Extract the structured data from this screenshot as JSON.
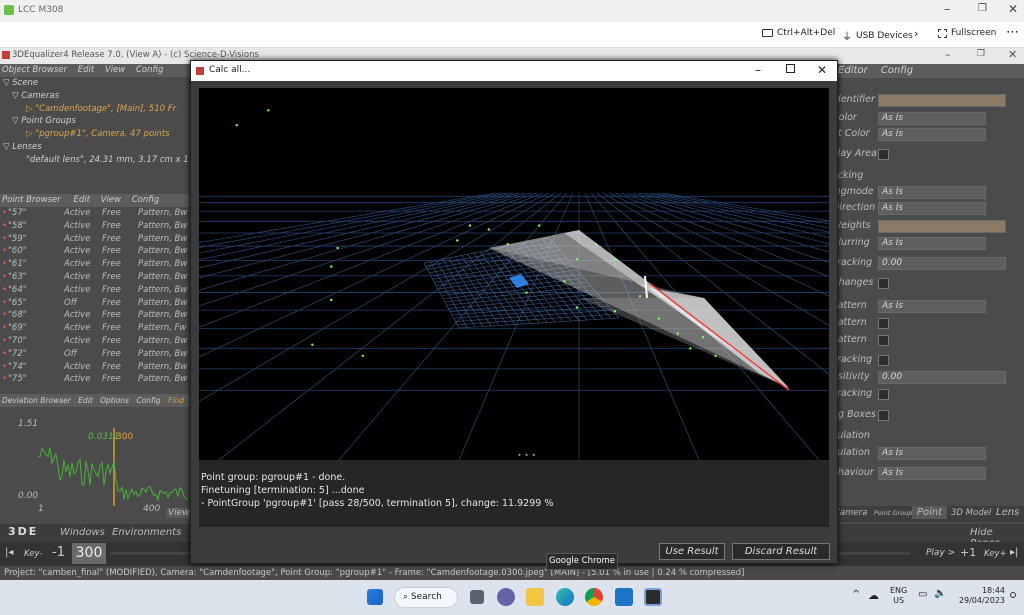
{
  "rd": {
    "title": "LCC M308",
    "ctrl_alt_del": "Ctrl+Alt+Del",
    "usb": "USB Devices",
    "fullscreen": "Fullscreen"
  },
  "app": {
    "title": "3DEqualizer4 Release 7.0, (View A)  -  (c) Science-D-Visions"
  },
  "object_browser": {
    "menu": [
      "Object Browser",
      "Edit",
      "View",
      "Config"
    ],
    "tree": [
      "Scene",
      "Cameras",
      "\"Camdenfootage\", [Main], 510 Fr",
      "Point Groups",
      "\"pgroup#1\", Camera, 47 points",
      "Lenses",
      "\"default lens\", 24.31 mm, 3.17 cm x 1"
    ]
  },
  "point_browser": {
    "menu": [
      "Point Browser",
      "Edit",
      "View",
      "Config"
    ],
    "rows": [
      [
        "\"57\"",
        "Active",
        "Free",
        "Pattern, Bw"
      ],
      [
        "\"58\"",
        "Active",
        "Free",
        "Pattern, Bw"
      ],
      [
        "\"59\"",
        "Active",
        "Free",
        "Pattern, Bw"
      ],
      [
        "\"60\"",
        "Active",
        "Free",
        "Pattern, Bw"
      ],
      [
        "\"61\"",
        "Active",
        "Free",
        "Pattern, Bw"
      ],
      [
        "\"63\"",
        "Active",
        "Free",
        "Pattern, Bw"
      ],
      [
        "\"64\"",
        "Active",
        "Free",
        "Pattern, Bw"
      ],
      [
        "\"65\"",
        "Off",
        "Free",
        "Pattern, Bw"
      ],
      [
        "\"68\"",
        "Active",
        "Free",
        "Pattern, Bw"
      ],
      [
        "\"69\"",
        "Active",
        "Free",
        "Pattern, Fw"
      ],
      [
        "\"70\"",
        "Active",
        "Free",
        "Pattern, Bw"
      ],
      [
        "\"72\"",
        "Off",
        "Free",
        "Pattern, Bw"
      ],
      [
        "\"74\"",
        "Active",
        "Free",
        "Pattern, Bw"
      ],
      [
        "\"75\"",
        "Active",
        "Free",
        "Pattern, Bw"
      ]
    ]
  },
  "deviation_browser": {
    "menu": [
      "Deviation Browser",
      "Edit",
      "Options",
      "Config",
      "Find"
    ],
    "ymax": "1.51",
    "ymin": "0.00",
    "xmin": "1",
    "xmax": "400",
    "value": "0.0311",
    "frame": "300",
    "view_btn": "View"
  },
  "dialog": {
    "title": "Calc all...",
    "console": [
      "Point group: pgroup#1 -  done.",
      "Finetuning [termination: 5] ...done",
      "- PointGroup 'pgroup#1'  [pass 28/500, termination 5], change: 11.9299 %"
    ],
    "use_result": "Use Result",
    "discard_result": "Discard Result"
  },
  "attribute_editor": {
    "menu": [
      "Editor",
      "Config"
    ],
    "rows": [
      {
        "label": "Identifier",
        "type": "text",
        "value": ""
      },
      {
        "label": "Color",
        "type": "select",
        "value": "As Is"
      },
      {
        "label": "nt Color",
        "type": "select",
        "value": "As Is"
      },
      {
        "label": "Play Area",
        "type": "check"
      },
      {
        "label": "acking",
        "type": "section"
      },
      {
        "label": "ingmode",
        "type": "select",
        "value": "As Is"
      },
      {
        "label": "Direction",
        "type": "select",
        "value": "As Is"
      },
      {
        "label": "Weights",
        "type": "text",
        "value": ""
      },
      {
        "label": "Blurring",
        "type": "select",
        "value": "As Is"
      },
      {
        "label": "Tracking",
        "type": "num",
        "value": "0.00"
      },
      {
        "label": "Changes",
        "type": "check"
      },
      {
        "label": "Pattern",
        "type": "select",
        "value": "As Is"
      },
      {
        "label": "Pattern",
        "type": "check"
      },
      {
        "label": "Pattern",
        "type": "check"
      },
      {
        "label": "Tracking",
        "type": "check"
      },
      {
        "label": "nsitivity",
        "type": "num",
        "value": "0.00"
      },
      {
        "label": "Tracking",
        "type": "check"
      },
      {
        "label": "ng Boxes",
        "type": "check"
      },
      {
        "label": "culation",
        "type": "section"
      },
      {
        "label": "culation",
        "type": "select",
        "value": "As Is"
      },
      {
        "label": "ehaviour",
        "type": "select",
        "value": "As Is"
      }
    ],
    "tabs": [
      "Camera",
      "Point Group",
      "Point",
      "3D Model",
      "Lens"
    ]
  },
  "bottombar": {
    "logo": "3DE",
    "windows": "Windows",
    "environments": "Environments",
    "hide_panes": "Hide Panes"
  },
  "timeline": {
    "key_minus": "Key-",
    "frame_neg": "-1",
    "frame": "300",
    "play": "Play >",
    "plus1": "+1",
    "key_plus": "Key+"
  },
  "status": "Project: \"camben_final\" (MODIFIED), Camera: \"Camdenfootage\", Point Group: \"pgroup#1\" - Frame: \"Camdenfootage.0300.jpeg\" [MAIN] - [5.01 % in use | 0.24 % compressed]",
  "tooltip": "Google Chrome",
  "taskbar": {
    "search": "Search",
    "lang1": "ENG",
    "lang2": "US",
    "time": "18:44",
    "date": "29/04/2023"
  },
  "colors": {
    "accent": "#3b78c5",
    "red_curve": "#e23c3c",
    "point": "#7cff5a"
  },
  "viewport_points": [
    [
      0.06,
      0.1
    ],
    [
      0.11,
      0.06
    ],
    [
      0.21,
      0.48
    ],
    [
      0.22,
      0.43
    ],
    [
      0.21,
      0.57
    ],
    [
      0.18,
      0.69
    ],
    [
      0.26,
      0.72
    ],
    [
      0.41,
      0.41
    ],
    [
      0.43,
      0.37
    ],
    [
      0.46,
      0.38
    ],
    [
      0.49,
      0.42
    ],
    [
      0.54,
      0.37
    ],
    [
      0.6,
      0.46
    ],
    [
      0.63,
      0.42
    ],
    [
      0.66,
      0.46
    ],
    [
      0.7,
      0.56
    ],
    [
      0.73,
      0.62
    ],
    [
      0.76,
      0.66
    ],
    [
      0.78,
      0.7
    ],
    [
      0.8,
      0.67
    ],
    [
      0.82,
      0.72
    ],
    [
      0.6,
      0.59
    ],
    [
      0.66,
      0.6
    ],
    [
      0.58,
      0.52
    ],
    [
      0.52,
      0.55
    ]
  ]
}
